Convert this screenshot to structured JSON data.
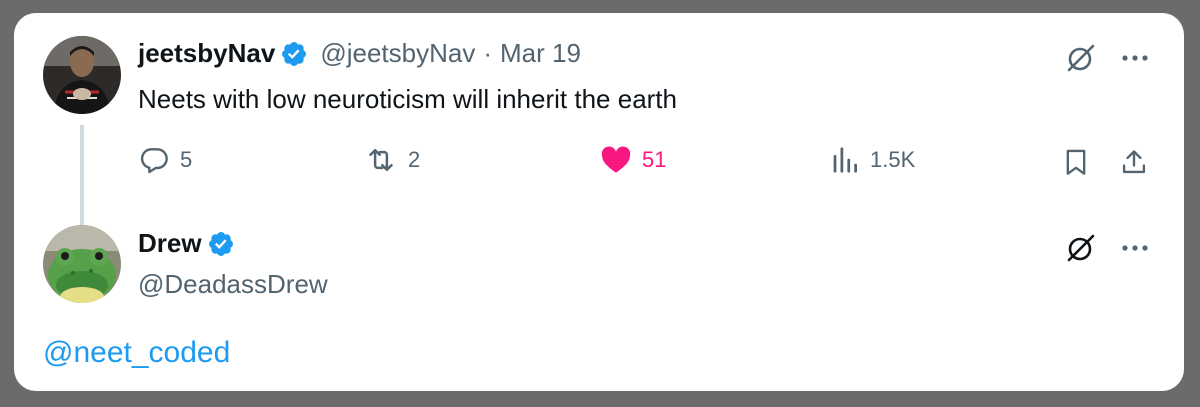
{
  "tweet": {
    "author": {
      "display_name": "jeetsbyNav",
      "handle": "@jeetsbyNav",
      "verified": true
    },
    "separator": "·",
    "date": "Mar 19",
    "text": "Neets with low neuroticism will inherit the earth",
    "actions": {
      "replies": "5",
      "reposts": "2",
      "likes": "51",
      "views": "1.5K",
      "liked": true
    }
  },
  "reply": {
    "author": {
      "display_name": "Drew",
      "handle": "@DeadassDrew",
      "verified": true
    },
    "text": "@neet_coded"
  },
  "colors": {
    "accent": "#1d9bf0",
    "like": "#f91880",
    "muted": "#536471",
    "text": "#0f1419",
    "thread_line": "#cfd9de"
  },
  "icons": {
    "grok": "grok-icon",
    "more": "more-icon",
    "reply": "reply-icon",
    "repost": "repost-icon",
    "like": "heart-icon",
    "views": "views-icon",
    "bookmark": "bookmark-icon",
    "share": "share-icon",
    "verified": "verified-badge-icon"
  }
}
